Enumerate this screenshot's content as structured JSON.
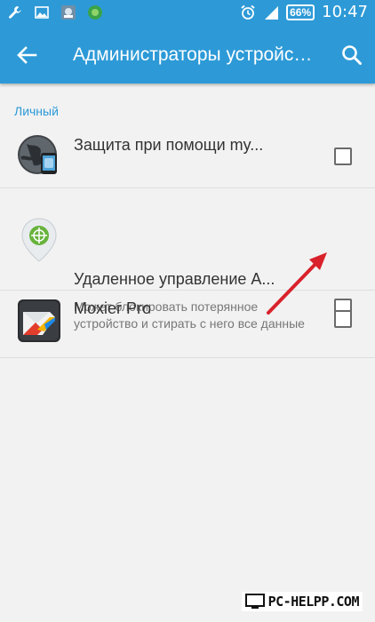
{
  "status_bar": {
    "battery": "66%",
    "time": "10:47",
    "icons": [
      "wrench-icon",
      "image-icon",
      "app-notification-icon",
      "green-app-icon",
      "alarm-icon",
      "signal-icon",
      "battery-icon"
    ]
  },
  "toolbar": {
    "title": "Администраторы устройства",
    "back_icon": "arrow-left-icon",
    "search_icon": "search-icon"
  },
  "section": {
    "label": "Личный"
  },
  "admins": [
    {
      "title": "Защита при помощи my...",
      "description": "",
      "checked": false,
      "icon": "globe-phone-icon"
    },
    {
      "title": "Удаленное управление A...",
      "description": "Может блокировать потерянное устройство и стирать с него все данные",
      "checked": false,
      "icon": "location-pin-icon"
    },
    {
      "title": "Moxier Pro",
      "description": "",
      "checked": false,
      "icon": "moxier-envelope-icon"
    }
  ],
  "watermark": {
    "text": "PC-HELPP.COM"
  },
  "colors": {
    "accent": "#2d9ad7",
    "background": "#f2f2f2",
    "arrow": "#d9222b"
  }
}
